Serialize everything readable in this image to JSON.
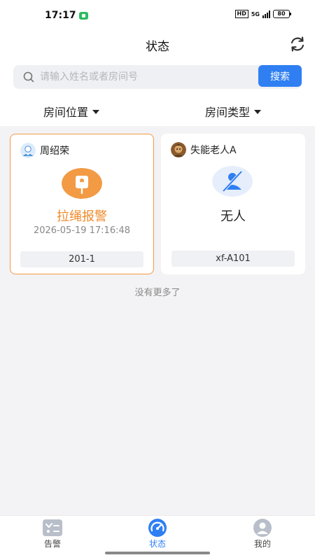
{
  "status_bar": {
    "time": "17:17",
    "network_badge": "HD",
    "network_type": "5G",
    "battery": "80"
  },
  "header": {
    "title": "状态",
    "refresh_icon": "refresh-icon"
  },
  "search": {
    "placeholder": "请输入姓名或者房间号",
    "value": "",
    "button_label": "搜索"
  },
  "filters": {
    "room_location": "房间位置",
    "room_type": "房间类型"
  },
  "cards": [
    {
      "name": "周绍荣",
      "avatar": "elder-avatar-icon",
      "status_icon": "pull-cord-alarm-icon",
      "status": "拉绳报警",
      "time": "2026-05-19 17:16:48",
      "room": "201-1",
      "accent_color": "#f29a44"
    },
    {
      "name": "失能老人A",
      "avatar": "photo-avatar-icon",
      "status_icon": "no-person-icon",
      "status": "无人",
      "time": "",
      "room": "xf-A101",
      "accent_color": "#2f7ff3"
    }
  ],
  "list_footer": "没有更多了",
  "tabs": [
    {
      "label": "告警",
      "icon": "alert-list-icon",
      "active": false
    },
    {
      "label": "状态",
      "icon": "gauge-icon",
      "active": true
    },
    {
      "label": "我的",
      "icon": "profile-icon",
      "active": false
    }
  ],
  "colors": {
    "primary": "#2f7ff3",
    "alarm": "#ef8a2b",
    "background": "#f3f3f5"
  }
}
